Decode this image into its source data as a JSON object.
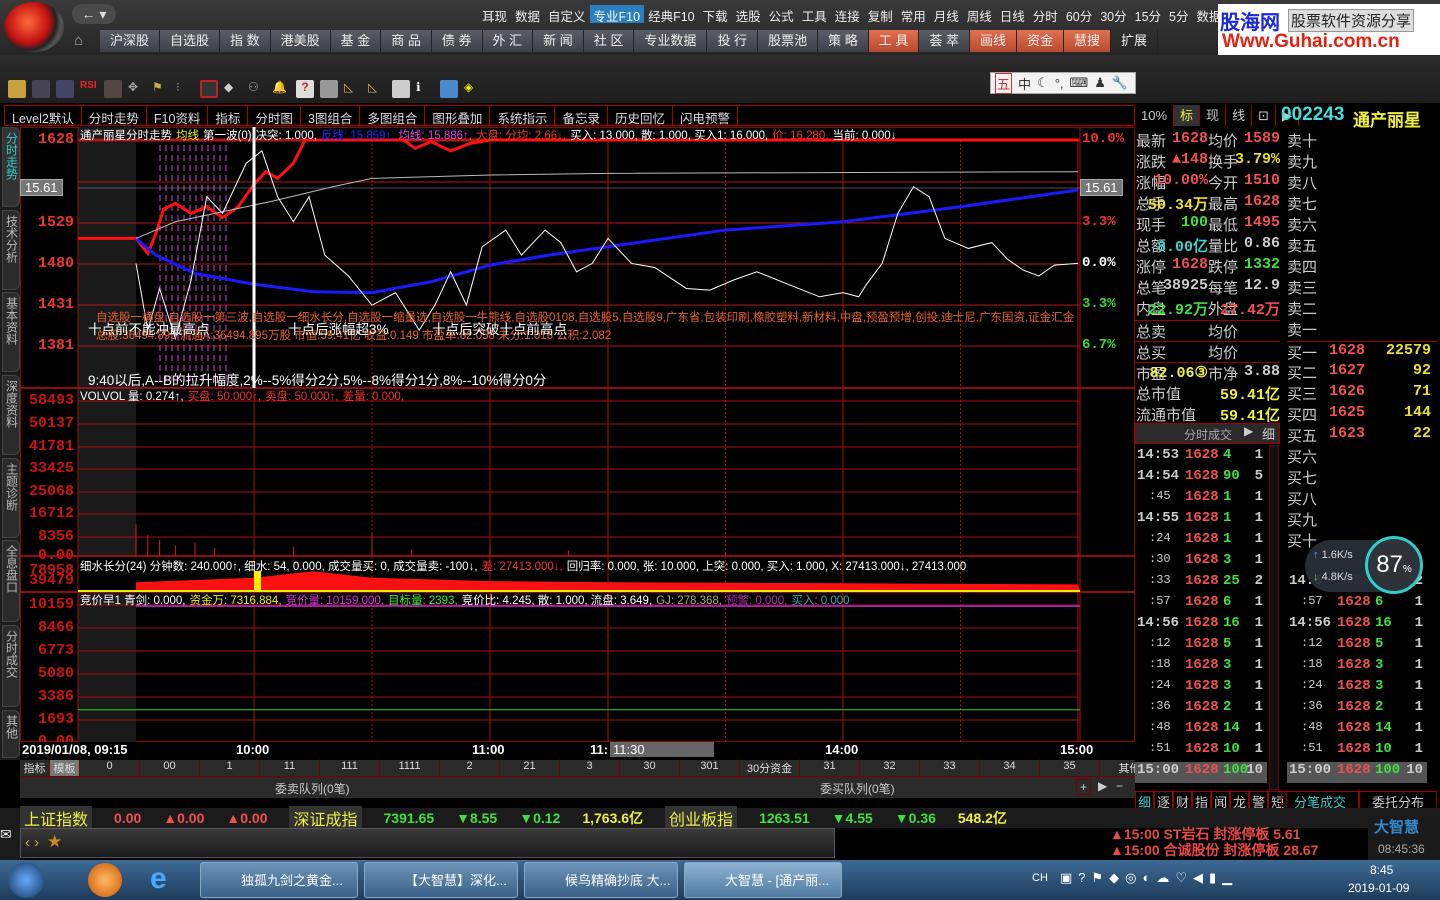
{
  "menu_top": [
    "耳现",
    "数据",
    "自定义",
    "专业F10",
    "经典F10",
    "下载",
    "选股",
    "公式",
    "工具",
    "连接",
    "复制",
    "常用",
    "月线",
    "周线",
    "日线",
    "分时",
    "60分",
    "30分",
    "15分",
    "5分",
    "数据菜单"
  ],
  "menu_active": "专业F10",
  "nav": [
    "沪深股",
    "自选股",
    "指 数",
    "港美股",
    "基 金",
    "商 品",
    "债 券",
    "外 汇",
    "新 闻",
    "社 区",
    "专业数据",
    "投 行",
    "股票池",
    "策 略",
    "工 具",
    "荟 萃",
    "画线",
    "资金",
    "慧搜",
    "扩展"
  ],
  "ad": {
    "title": "股海网",
    "slogan": "股票软件资源分享",
    "url": "Www.Guhai.com.cn"
  },
  "ime": [
    "五",
    "中"
  ],
  "tabs": [
    "Level2默认",
    "分时走势",
    "F10资料",
    "指标",
    "分时图",
    "3图组合",
    "多图组合",
    "图形叠加",
    "系统指示",
    "备忘录",
    "历史回忆",
    "闪电预警"
  ],
  "side_tabs": [
    "分时走势",
    "技术分析",
    "基本资料",
    "深度资料",
    "主题诊断",
    "全息盘口",
    "分时成交",
    "其他"
  ],
  "main_chart": {
    "header": [
      {
        "t": "通产丽星分时走势",
        "c": "#fff"
      },
      {
        "t": "均线",
        "c": "#ee0"
      },
      {
        "t": "第一波(0)",
        "c": "#fff"
      },
      {
        "t": "决突: 1.000,",
        "c": "#fff"
      },
      {
        "t": "反线: 15.859↑,",
        "c": "#22f"
      },
      {
        "t": "均线: 15.886↑,",
        "c": "#d4d"
      },
      {
        "t": "大盘: 分均: 2.66↓,",
        "c": "#e33"
      },
      {
        "t": "买入: 13.000, 散: 1.000, 买入1: 16.000,",
        "c": "#fff"
      },
      {
        "t": "价: 16.280,",
        "c": "#e33"
      },
      {
        "t": "当前: 0.000↓",
        "c": "#fff"
      }
    ],
    "left_axis": [
      "1628",
      "1529",
      "1480",
      "1431",
      "1381"
    ],
    "right_axis": [
      "10.0%",
      "3.3%",
      "0.0%",
      "3.3%",
      "6.7%"
    ],
    "crosshair_price": "15.61",
    "annotations": [
      "十点前不能冲最高点",
      "十点后涨幅超3%",
      "十点后突破十点前高点",
      "9:40以后,A--B的拉升幅度,2%--5%得分2分,5%--8%得分1分,8%--10%得分0分"
    ],
    "tags": "自选股一横盘,自选股一第三波,自选股一细水长分,自选股一缩量选,自选股一牛熊线,自选股0108,自选股5,自选股9,广东省,包装印刷,橡胶塑料,新材料,中盘,预盈预增,创投,迪士尼,广东国资,证金汇金",
    "fundamentals": "总股:36494.895 流通A:36494.895万股 市值:59.41亿 收益:0.149 市盈率:82.058 未分:1.016 公积:2.082"
  },
  "vol_pane": {
    "header": [
      {
        "t": "VOLVOL 量: 0.274↑,",
        "c": "#fff"
      },
      {
        "t": "买盘: 50.000↑,",
        "c": "#e33"
      },
      {
        "t": "卖盘: 50.000↑,",
        "c": "#e33"
      },
      {
        "t": "差量: 0.000,",
        "c": "#e33"
      }
    ],
    "axis": [
      "58493",
      "50137",
      "41781",
      "33425",
      "25068",
      "16712",
      "8356",
      "0.00"
    ]
  },
  "flow_pane": {
    "header": [
      {
        "t": "细水长分(24) 分钟数: 240.000↑, 细水: 54, 0.000, 成交量买: 0, 成交量卖: -100↓,",
        "c": "#fff"
      },
      {
        "t": "差: 27413.000↓,",
        "c": "#e33"
      },
      {
        "t": "回归率: 0.000, 张: 10.000, 上突: 0.000, 买入: 1.000, X: 27413.000↓, 27413.000",
        "c": "#fff"
      }
    ],
    "axis": [
      "78958",
      "39479"
    ]
  },
  "auction_pane": {
    "header": [
      {
        "t": "竞价早1 青剑: 0.000,",
        "c": "#fff"
      },
      {
        "t": "资金万: 7316.884,",
        "c": "#ee0"
      },
      {
        "t": "竞价量: 10159.000,",
        "c": "#d3d"
      },
      {
        "t": "目标量: 2393,",
        "c": "#3e3"
      },
      {
        "t": "竞价比: 4.245, 散: 1.000, 流盘: 3.649,",
        "c": "#fff"
      },
      {
        "t": "GJ: 278.368,",
        "c": "#aa8"
      },
      {
        "t": "预警: 0.000,",
        "c": "#a3a"
      },
      {
        "t": "买入: 0.000",
        "c": "#3aa"
      }
    ],
    "axis": [
      "10159",
      "8466",
      "6773",
      "5080",
      "3386",
      "1693",
      "0.00"
    ]
  },
  "time_axis": {
    "start": "2019/01/08, 09:15",
    "labels": [
      "10:00",
      "11:00",
      "11:",
      "14:00",
      "15:00"
    ],
    "cursor": "11:30"
  },
  "indicator_tabs": [
    "指标",
    "模板",
    "0",
    "00",
    "1",
    "11",
    "111",
    "1111",
    "2",
    "21",
    "3",
    "30",
    "301",
    "30分资金",
    "31",
    "32",
    "33",
    "34",
    "35",
    "其他"
  ],
  "queue": {
    "sell": "委卖队列(0笔)",
    "buy": "委买队列(0笔)"
  },
  "chart_data": {
    "type": "line",
    "title": "通产丽星分时走势",
    "ylim": [
      1381,
      1628
    ],
    "prev_close": 1480,
    "series": [
      {
        "name": "price",
        "color": "#ff1010",
        "points": [
          [
            "09:15",
            1510
          ],
          [
            "09:30",
            1510
          ],
          [
            "09:33",
            1492
          ],
          [
            "09:35",
            1515
          ],
          [
            "09:37",
            1545
          ],
          [
            "09:40",
            1552
          ],
          [
            "09:44",
            1540
          ],
          [
            "09:48",
            1548
          ],
          [
            "09:52",
            1535
          ],
          [
            "09:56",
            1548
          ],
          [
            "10:00",
            1575
          ],
          [
            "10:03",
            1590
          ],
          [
            "10:06",
            1582
          ],
          [
            "10:10",
            1600
          ],
          [
            "10:13",
            1628
          ],
          [
            "10:38",
            1628
          ],
          [
            "10:41",
            1618
          ],
          [
            "10:45",
            1626
          ],
          [
            "10:50",
            1615
          ],
          [
            "10:55",
            1624
          ],
          [
            "11:00",
            1628
          ],
          [
            "11:30",
            1628
          ],
          [
            "15:00",
            1628
          ]
        ]
      },
      {
        "name": "blue_line",
        "color": "#1a1aff",
        "points": [
          [
            "09:30",
            1510
          ],
          [
            "09:35",
            1490
          ],
          [
            "09:45",
            1468
          ],
          [
            "10:00",
            1455
          ],
          [
            "10:15",
            1446
          ],
          [
            "10:30",
            1445
          ],
          [
            "10:45",
            1458
          ],
          [
            "11:00",
            1478
          ],
          [
            "11:15",
            1490
          ],
          [
            "11:30",
            1500
          ],
          [
            "13:30",
            1520
          ],
          [
            "14:00",
            1530
          ],
          [
            "14:30",
            1548
          ],
          [
            "15:00",
            1568
          ]
        ]
      },
      {
        "name": "avg_price",
        "color": "#bbbbbb",
        "points": [
          [
            "09:30",
            1510
          ],
          [
            "09:40",
            1530
          ],
          [
            "09:55",
            1545
          ],
          [
            "10:05",
            1555
          ],
          [
            "10:20",
            1572
          ],
          [
            "10:30",
            1582
          ],
          [
            "11:00",
            1586
          ],
          [
            "11:30",
            1588
          ],
          [
            "15:00",
            1590
          ]
        ]
      },
      {
        "name": "white_line",
        "color": "#ffffff",
        "points": [
          [
            "09:30",
            1480
          ],
          [
            "09:33",
            1400
          ],
          [
            "09:36",
            1450
          ],
          [
            "09:40",
            1390
          ],
          [
            "09:44",
            1460
          ],
          [
            "09:48",
            1560
          ],
          [
            "09:52",
            1540
          ],
          [
            "09:58",
            1600
          ],
          [
            "10:02",
            1615
          ],
          [
            "10:06",
            1560
          ],
          [
            "10:10",
            1530
          ],
          [
            "10:14",
            1560
          ],
          [
            "10:18",
            1490
          ],
          [
            "10:24",
            1465
          ],
          [
            "10:30",
            1430
          ],
          [
            "10:36",
            1445
          ],
          [
            "10:42",
            1400
          ],
          [
            "10:46",
            1430
          ],
          [
            "10:50",
            1470
          ],
          [
            "10:54",
            1430
          ],
          [
            "10:58",
            1500
          ],
          [
            "11:04",
            1520
          ],
          [
            "11:08",
            1490
          ],
          [
            "11:14",
            1520
          ],
          [
            "11:18",
            1505
          ],
          [
            "11:22",
            1470
          ],
          [
            "11:26",
            1480
          ],
          [
            "11:30",
            1510
          ],
          [
            "13:06",
            1480
          ],
          [
            "13:12",
            1475
          ],
          [
            "13:20",
            1450
          ],
          [
            "13:26",
            1448
          ],
          [
            "13:32",
            1460
          ],
          [
            "13:38",
            1470
          ],
          [
            "13:46",
            1455
          ],
          [
            "13:54",
            1440
          ],
          [
            "14:00",
            1445
          ],
          [
            "14:04",
            1440
          ],
          [
            "14:06",
            1455
          ],
          [
            "14:10",
            1480
          ],
          [
            "14:14",
            1540
          ],
          [
            "14:18",
            1572
          ],
          [
            "14:22",
            1560
          ],
          [
            "14:26",
            1510
          ],
          [
            "14:32",
            1498
          ],
          [
            "14:38",
            1505
          ],
          [
            "14:42",
            1485
          ],
          [
            "14:46",
            1472
          ],
          [
            "14:50",
            1465
          ],
          [
            "14:54",
            1478
          ],
          [
            "15:00",
            1480
          ]
        ]
      }
    ],
    "volume": [
      [
        "09:30",
        12000
      ],
      [
        "09:33",
        8000
      ],
      [
        "09:36",
        6000
      ],
      [
        "09:40",
        4000
      ],
      [
        "09:45",
        5000
      ],
      [
        "09:50",
        3000
      ],
      [
        "10:00",
        2500
      ],
      [
        "10:10",
        3500
      ],
      [
        "10:30",
        9000
      ],
      [
        "10:40",
        2500
      ],
      [
        "11:00",
        4000
      ],
      [
        "11:20",
        2000
      ],
      [
        "13:30",
        1500
      ],
      [
        "14:00",
        1200
      ],
      [
        "15:00",
        1000
      ]
    ],
    "flow_fill": [
      [
        "09:30",
        0.4
      ],
      [
        "10:00",
        0.6
      ],
      [
        "10:15",
        0.9
      ],
      [
        "10:30",
        0.6
      ],
      [
        "11:00",
        0.45
      ],
      [
        "11:30",
        0.4
      ],
      [
        "14:00",
        0.35
      ],
      [
        "15:00",
        0.3
      ]
    ],
    "auction_target": 2393
  },
  "quote": {
    "head": [
      "10%",
      "标",
      "现",
      "线"
    ],
    "code": "002243",
    "name": "通产丽星",
    "left": [
      [
        "最新",
        "1628",
        "#f05050"
      ],
      [
        "涨跌",
        "▲148",
        "#f05050"
      ],
      [
        "涨幅",
        "10.00%",
        "#f05050"
      ],
      [
        "总手",
        "50.34万",
        "#e8e030"
      ],
      [
        "现手",
        "100",
        "#40e040"
      ],
      [
        "总额",
        "8.00亿",
        "#40d0d0"
      ],
      [
        "涨停",
        "1628",
        "#f05050"
      ],
      [
        "总笔",
        "38925",
        "#ccc"
      ],
      [
        "内盘",
        "22.92万",
        "#40e040"
      ]
    ],
    "right": [
      [
        "均价",
        "1589",
        "#f05050"
      ],
      [
        "换手",
        "3.79%",
        "#e8e030"
      ],
      [
        "今开",
        "1510",
        "#f05050"
      ],
      [
        "最高",
        "1628",
        "#f05050"
      ],
      [
        "最低",
        "1495",
        "#f05050"
      ],
      [
        "量比",
        "0.86",
        "#ccc"
      ],
      [
        "跌停",
        "1332",
        "#40e040"
      ],
      [
        "每笔",
        "12.9",
        "#ccc"
      ],
      [
        "外盘",
        "27.42万",
        "#f05050"
      ]
    ],
    "total_sell": [
      "总卖",
      "均价"
    ],
    "total_buy": [
      "总买",
      "均价"
    ],
    "pe": [
      "市盈",
      "82.06③",
      "市净",
      "3.88"
    ],
    "mktcap": [
      "总市值",
      "59.41亿"
    ],
    "float_cap": [
      "流通市值",
      "59.41亿"
    ],
    "sell": [
      [
        "卖十",
        "",
        ""
      ],
      [
        "卖九",
        "",
        ""
      ],
      [
        "卖八",
        "",
        ""
      ],
      [
        "卖七",
        "",
        ""
      ],
      [
        "卖六",
        "",
        ""
      ],
      [
        "卖五",
        "",
        ""
      ],
      [
        "卖四",
        "",
        ""
      ],
      [
        "卖三",
        "",
        ""
      ],
      [
        "卖二",
        "",
        ""
      ],
      [
        "卖一",
        "",
        ""
      ]
    ],
    "buy": [
      [
        "买一",
        "1628",
        "22579"
      ],
      [
        "买二",
        "1627",
        "92"
      ],
      [
        "买三",
        "1626",
        "71"
      ],
      [
        "买四",
        "1625",
        "144"
      ],
      [
        "买五",
        "1623",
        "22"
      ],
      [
        "买六",
        "",
        ""
      ],
      [
        "买七",
        "",
        ""
      ],
      [
        "买八",
        "",
        ""
      ],
      [
        "买九",
        "",
        ""
      ],
      [
        "买十",
        "",
        ""
      ]
    ],
    "ticks_title": "分时成交",
    "ticks_detail": "细",
    "ticks": [
      [
        "14:53",
        "1628",
        "4",
        "1"
      ],
      [
        "14:54",
        "1628",
        "90",
        "5"
      ],
      [
        ":45",
        "1628",
        "1",
        "1"
      ],
      [
        "14:55",
        "1628",
        "1",
        "1"
      ],
      [
        ":24",
        "1628",
        "1",
        "1"
      ],
      [
        ":30",
        "1628",
        "3",
        "1"
      ],
      [
        ":33",
        "1628",
        "25",
        "2"
      ],
      [
        ":57",
        "1628",
        "6",
        "1"
      ],
      [
        "14:56",
        "1628",
        "16",
        "1"
      ],
      [
        ":12",
        "1628",
        "5",
        "1"
      ],
      [
        ":18",
        "1628",
        "3",
        "1"
      ],
      [
        ":24",
        "1628",
        "3",
        "1"
      ],
      [
        ":36",
        "1628",
        "2",
        "1"
      ],
      [
        ":48",
        "1628",
        "14",
        "1"
      ],
      [
        ":51",
        "1628",
        "10",
        "1"
      ],
      [
        "15:00",
        "1628",
        "100",
        "10"
      ]
    ],
    "ticks2": [
      [
        "14:5",
        "1628",
        "25",
        "2"
      ],
      [
        ":57",
        "1628",
        "6",
        "1"
      ],
      [
        "14:56",
        "1628",
        "16",
        "1"
      ],
      [
        ":12",
        "1628",
        "5",
        "1"
      ],
      [
        ":18",
        "1628",
        "3",
        "1"
      ],
      [
        ":24",
        "1628",
        "3",
        "1"
      ],
      [
        ":36",
        "1628",
        "2",
        "1"
      ],
      [
        ":48",
        "1628",
        "14",
        "1"
      ],
      [
        ":51",
        "1628",
        "10",
        "1"
      ],
      [
        "15:00",
        "1628",
        "100",
        "10"
      ]
    ],
    "bottom_tabs": [
      "细",
      "逐",
      "财",
      "指",
      "闻",
      "龙",
      "警",
      "短"
    ],
    "bottom_tabs2": [
      "分笔成交",
      "委托分布"
    ]
  },
  "net": {
    "percent": "87",
    "unit": "%",
    "up": "1.6K/s",
    "down": "4.8K/s"
  },
  "indexes": [
    {
      "name": "上证指数",
      "v": "0.00",
      "c": "▲0.00",
      "p": "▲0.00",
      "amt": "",
      "color": "#f05050"
    },
    {
      "name": "深证成指",
      "v": "7391.65",
      "c": "▼8.55",
      "p": "▼0.12",
      "amt": "1,763.6亿",
      "color": "#40e040"
    },
    {
      "name": "创业板指",
      "v": "1263.51",
      "c": "▼4.55",
      "p": "▼0.36",
      "amt": "548.2亿",
      "color": "#40e040"
    }
  ],
  "alerts": [
    "▲15:00 ST岩石  封涨停板 5.61",
    "▲15:00 合诚股份 封涨停板 28.67"
  ],
  "brand": "大智慧",
  "clock": "08:45:36",
  "taskbar": {
    "items": [
      "独孤九剑之黄金...",
      "【大智慧】深化...",
      "候鸟精确抄底  大...",
      "大智慧 - [通产丽..."
    ],
    "lang": "CH",
    "time": "8:45",
    "date": "2019-01-09"
  }
}
